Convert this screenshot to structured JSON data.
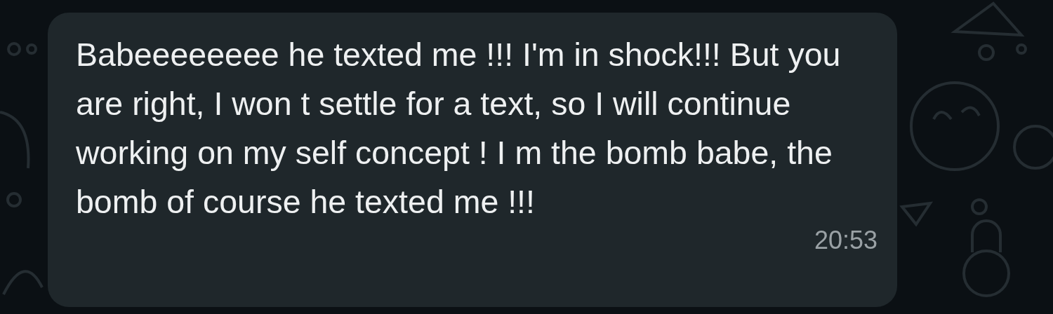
{
  "message": {
    "text": "Babeeeeeeee he texted me !!! I'm in shock!!! But you are right, I won t settle for a text, so I will continue working on my self concept ! I m the bomb babe, the bomb of course he texted me !!!",
    "time": "20:53"
  }
}
